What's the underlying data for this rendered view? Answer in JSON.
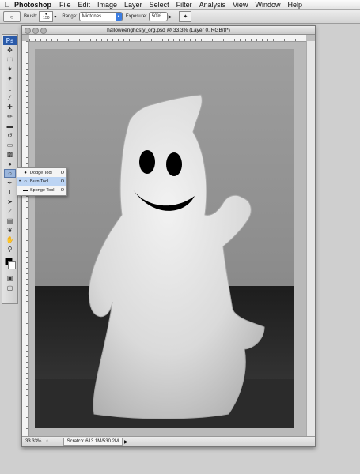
{
  "menubar": {
    "apple_icon": "apple-icon",
    "app_name": "Photoshop",
    "items": [
      "File",
      "Edit",
      "Image",
      "Layer",
      "Select",
      "Filter",
      "Analysis",
      "View",
      "Window",
      "Help"
    ]
  },
  "options": {
    "brush_label": "Brush:",
    "brush_size": "150",
    "range_label": "Range:",
    "range_value": "Midtones",
    "exposure_label": "Exposure:",
    "exposure_value": "50%"
  },
  "document": {
    "title": "halloweenghosty_org.psd @ 33.3% (Layer 0, RGB/8*)",
    "zoom": "33.33%",
    "status_info": "Scratch: 613.1M/530.2M"
  },
  "flyout": {
    "items": [
      {
        "label": "Dodge Tool",
        "key": "O",
        "selected": false
      },
      {
        "label": "Burn Tool",
        "key": "O",
        "selected": true
      },
      {
        "label": "Sponge Tool",
        "key": "O",
        "selected": false
      }
    ]
  },
  "colors": {
    "ps_logo": "#2a5aa8",
    "selection": "#bcd4f3",
    "foreground": "#000000",
    "background": "#ffffff"
  }
}
